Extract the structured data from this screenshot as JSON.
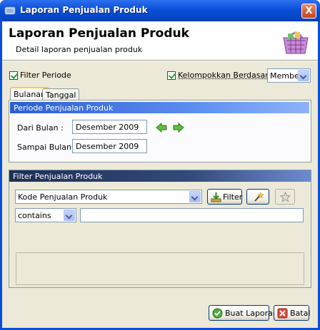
{
  "window": {
    "title": "Laporan Penjualan Produk",
    "close_label": "X"
  },
  "header": {
    "title": "Laporan Penjualan Produk",
    "subtitle": "Detail laporan penjualan produk"
  },
  "options": {
    "filter_periode_label": "Filter Periode",
    "filter_periode_checked": true,
    "group_by_label": "Kelompokkan Berdasarkan :",
    "group_by_checked": true,
    "group_by_value": "Member"
  },
  "tabs": [
    {
      "label": "Bulanan",
      "active": true
    },
    {
      "label": "Tanggal",
      "active": false
    }
  ],
  "periode": {
    "section_title": "Periode Penjualan Produk",
    "from_label": "Dari Bulan :",
    "from_value": "Desember 2009",
    "to_label": "Sampai Bulan :",
    "to_value": "Desember 2009"
  },
  "filter": {
    "section_title": "Filter Penjualan Produk",
    "field_value": "Kode Penjualan Produk",
    "filter_button_label": "Filter",
    "operator_value": "contains",
    "search_value": ""
  },
  "footer": {
    "create_report_label": "Buat Laporan",
    "cancel_label": "Batal"
  },
  "colors": {
    "titlebar": "#0a4fd8",
    "section_bar": "#2b5fd0",
    "window_bg": "#ece9d8"
  }
}
